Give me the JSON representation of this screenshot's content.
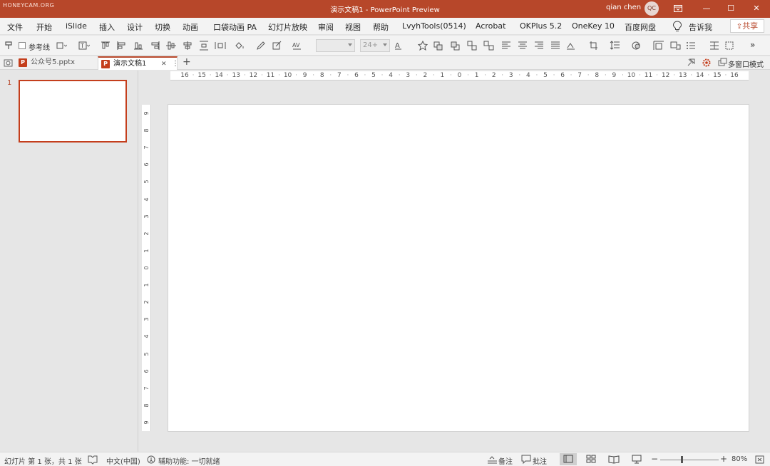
{
  "titlebar": {
    "watermark": "HONEYCAM.ORG",
    "title": "演示文稿1  -  PowerPoint Preview",
    "user_name": "qian chen",
    "user_initials": "QC",
    "ribbon_options_icon": "ribbon-display-icon",
    "minimize": "—",
    "maximize": "☐",
    "close": "✕"
  },
  "menubar": {
    "items": [
      "文件",
      "开始",
      "iSlide",
      "插入",
      "设计",
      "切换",
      "动画",
      "口袋动画 PA",
      "幻灯片放映",
      "审阅",
      "视图",
      "帮助",
      "LvyhTools(0514)",
      "Acrobat",
      "OKPlus 5.2",
      "OneKey 10",
      "百度网盘"
    ],
    "tell_me": "告诉我",
    "share": "共享"
  },
  "toolbar": {
    "guides_label": "参考线",
    "font_name": "",
    "font_size": "24+",
    "more": "»"
  },
  "tabs": {
    "inactive_tab": "公众号5.pptx",
    "active_tab": "演示文稿1",
    "close_tab": "✕",
    "more_menu": "⋮",
    "new_tab": "+",
    "multi_window": "多窗口模式"
  },
  "thumbnails": {
    "slide_number": "1"
  },
  "rulers": {
    "horizontal": [
      "16",
      "15",
      "14",
      "13",
      "12",
      "11",
      "10",
      "9",
      "8",
      "7",
      "6",
      "5",
      "4",
      "3",
      "2",
      "1",
      "0",
      "1",
      "2",
      "3",
      "4",
      "5",
      "6",
      "7",
      "8",
      "9",
      "10",
      "11",
      "12",
      "13",
      "14",
      "15",
      "16"
    ],
    "vertical": [
      "9",
      "8",
      "7",
      "6",
      "5",
      "4",
      "3",
      "2",
      "1",
      "0",
      "1",
      "2",
      "3",
      "4",
      "5",
      "6",
      "7",
      "8",
      "9"
    ]
  },
  "statusbar": {
    "slide_info": "幻灯片 第 1 张，共 1 张",
    "language": "中文(中国)",
    "accessibility": "辅助功能: 一切就绪",
    "notes": "备注",
    "comments": "批注",
    "zoom_minus": "−",
    "zoom_plus": "+",
    "zoom_level": "80%"
  },
  "colors": {
    "accent": "#b7472a",
    "thumb_border": "#c43e1c"
  }
}
